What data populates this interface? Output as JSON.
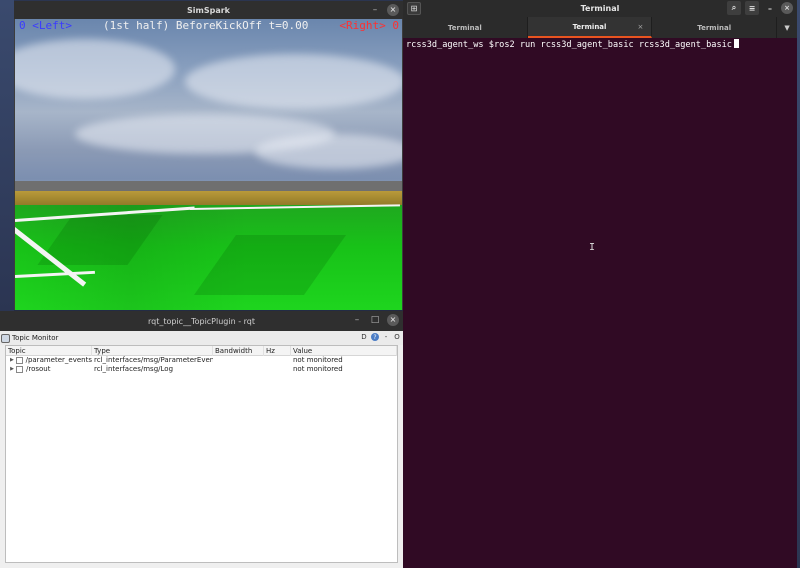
{
  "simspark": {
    "title": "SimSpark",
    "hud": {
      "left": "0 <Left>",
      "middle": "(1st half) BeforeKickOff t=0.00",
      "right": "<Right> 0"
    }
  },
  "rqt": {
    "title": "rqt_topic__TopicPlugin - rqt",
    "plugin_title": "Topic Monitor",
    "tools": {
      "d_label": "D",
      "help_label": "?",
      "dash_label": "-",
      "o_label": "O"
    },
    "columns": [
      "Topic",
      "Type",
      "Bandwidth",
      "Hz",
      "Value"
    ],
    "rows": [
      {
        "topic": "/parameter_events",
        "type": "rcl_interfaces/msg/ParameterEvent",
        "bandwidth": "",
        "hz": "",
        "value": "not monitored"
      },
      {
        "topic": "/rosout",
        "type": "rcl_interfaces/msg/Log",
        "bandwidth": "",
        "hz": "",
        "value": "not monitored"
      }
    ]
  },
  "terminal": {
    "title": "Terminal",
    "tabs": [
      {
        "label": "Terminal"
      },
      {
        "label": "Terminal",
        "active": true
      },
      {
        "label": "Terminal"
      }
    ],
    "prompt": "rcss3d_agent_ws $",
    "command": "ros2 run rcss3d_agent_basic rcss3d_agent_basic"
  },
  "window_controls": {
    "minimize": "–",
    "maximize": "□",
    "close": "×"
  },
  "colors": {
    "terminal_bg": "#300a24",
    "hud_left": "#3b3bff",
    "hud_right": "#ff3030",
    "active_tab_accent": "#e95420",
    "field_green": "#1ed51e"
  }
}
